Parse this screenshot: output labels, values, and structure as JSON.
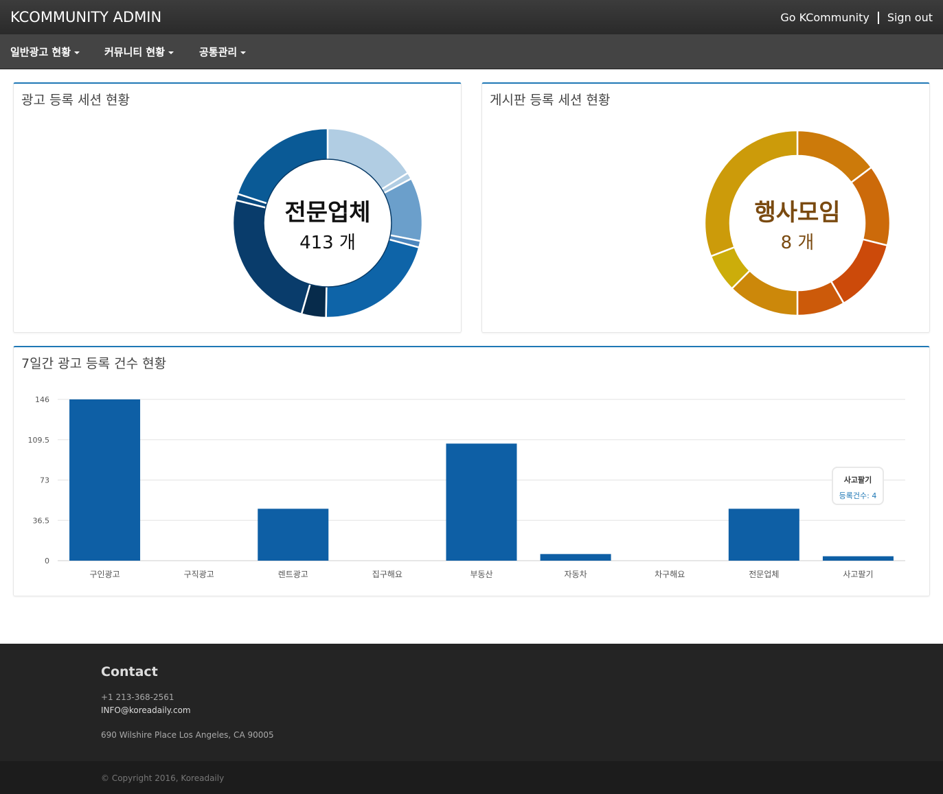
{
  "header": {
    "brand": "KCOMMUNITY ADMIN",
    "go_link": "Go KCommunity",
    "signout": "Sign out"
  },
  "nav": {
    "items": [
      "일반광고 현황",
      "커뮤니티 현황",
      "공통관리"
    ]
  },
  "panel_ad_sessions": {
    "title": "광고 등록 세션 현황",
    "center_label": "전문업체",
    "center_value": "413 개",
    "colors": [
      "#b1cde3",
      "#b1cde3",
      "#6b9fcb",
      "#4d87be",
      "#0e64a8",
      "#072b4b",
      "#093c6b",
      "#0a4a80",
      "#0a5a96"
    ]
  },
  "panel_board_sessions": {
    "title": "게시판 등록 세션 현황",
    "center_label": "행사모임",
    "center_value": "8 개",
    "center_color": "#7a4a10",
    "colors": [
      "#cc9b0a",
      "#cc6a0a",
      "#cc4a0a",
      "#cc5a0a",
      "#cc880a",
      "#ccad0a"
    ]
  },
  "bar_panel": {
    "title": "7일간 광고 등록 건수 현황"
  },
  "chart_data": {
    "type": "bar",
    "categories": [
      "구인광고",
      "구직광고",
      "렌트광고",
      "집구해요",
      "부동산",
      "자동차",
      "차구해요",
      "전문업체",
      "사고팔기"
    ],
    "values": [
      146,
      0,
      47,
      0,
      106,
      6,
      0,
      47,
      4
    ],
    "ylim": [
      0,
      146
    ],
    "yticks": [
      "146",
      "109.5",
      "73",
      "36.5",
      "0"
    ],
    "bar_color": "#0e5fa5",
    "grid": true,
    "tooltip": {
      "title": "사고팔기",
      "label": "등록건수: 4"
    }
  },
  "footer": {
    "contact_title": "Contact",
    "phone": "+1 213-368-2561",
    "email": "INFO@koreadaily.com",
    "address": "690 Wilshire Place Los Angeles, CA 90005",
    "copyright": "© Copyright 2016, Koreadaily"
  }
}
